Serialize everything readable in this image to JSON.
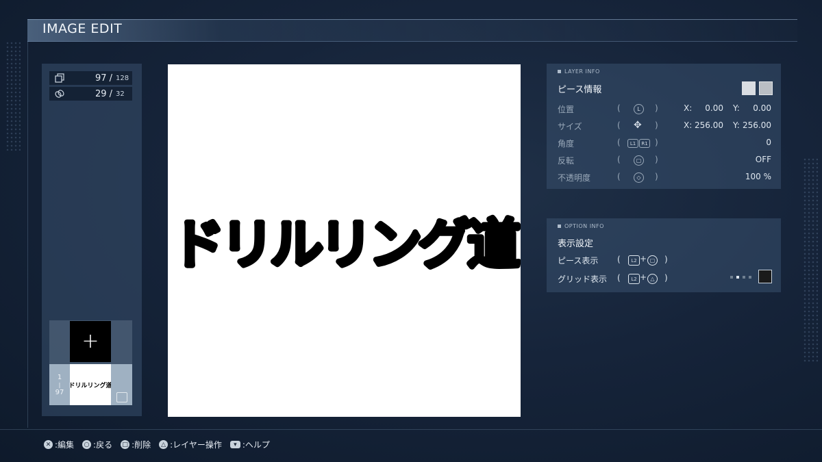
{
  "header": {
    "title": "IMAGE EDIT"
  },
  "counters": {
    "pieces": {
      "icon": "pieces-stack-icon",
      "current": "97 /",
      "max": "128"
    },
    "links": {
      "icon": "link-icon",
      "current": "29 /",
      "max": "32"
    }
  },
  "layer_list": {
    "add_symbol": "+",
    "items": [
      {
        "index_top": "1",
        "index_sep": "|",
        "index_bottom": "97",
        "thumb_text": "ドリルリング道"
      }
    ]
  },
  "canvas": {
    "image_text": "ドリルリング道"
  },
  "layer_info": {
    "section": "LAYER INFO",
    "title": "ピース情報",
    "rows": [
      {
        "label": "位置",
        "icon": "L",
        "icon_name": "left-stick-icon",
        "x_label": "X:",
        "x": "0.00",
        "y_label": "Y:",
        "y": "0.00"
      },
      {
        "label": "サイズ",
        "icon": "✥",
        "icon_name": "dpad-icon",
        "x_label": "X:",
        "x": "256.00",
        "y_label": "Y:",
        "y": "256.00"
      },
      {
        "label": "角度",
        "l1": "L1",
        "r1": "R1",
        "value": "0"
      },
      {
        "label": "反転",
        "icon": "▢",
        "icon_name": "square-button-icon",
        "value": "OFF"
      },
      {
        "label": "不透明度",
        "icon": "◇",
        "icon_name": "touchpad-icon",
        "value": "100 %"
      }
    ]
  },
  "option_info": {
    "section": "OPTION INFO",
    "title": "表示設定",
    "rows": [
      {
        "label": "ピース表示",
        "combo_a": "L2",
        "plus": "+",
        "combo_b": "▢"
      },
      {
        "label": "グリッド表示",
        "combo_a": "L2",
        "plus": "+",
        "combo_b": "△"
      }
    ],
    "grid_color": "#1a1a1a"
  },
  "footer": [
    {
      "icon": "cross-button-icon",
      "glyph": "✕",
      "text": ":編集"
    },
    {
      "icon": "circle-button-icon",
      "glyph": "○",
      "text": ":戻る"
    },
    {
      "icon": "square-button-icon",
      "glyph": "□",
      "text": ":削除"
    },
    {
      "icon": "triangle-button-icon",
      "glyph": "△",
      "text": ":レイヤー操作"
    },
    {
      "icon": "touchpad-button-icon",
      "glyph": "▾",
      "text": ":ヘルプ"
    }
  ],
  "colors": {
    "accent_panel": "#38506e",
    "canvas": "#ffffff"
  }
}
